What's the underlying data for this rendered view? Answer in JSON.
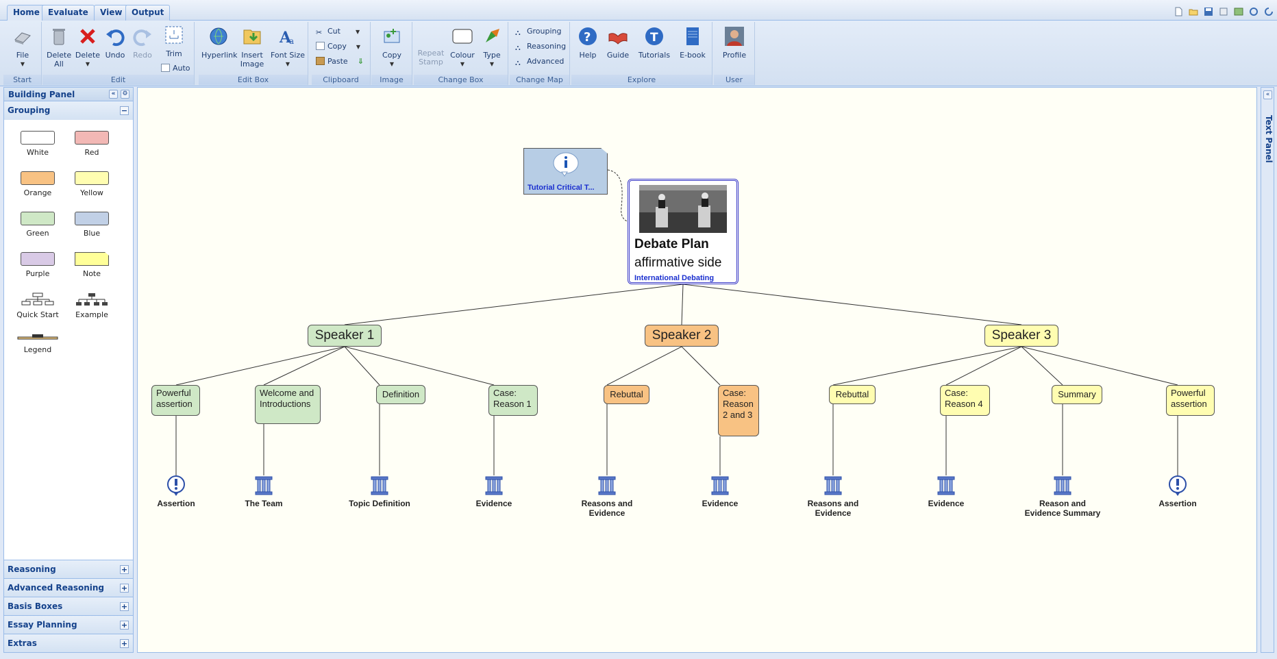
{
  "tabs": [
    "Home",
    "Evaluate",
    "View",
    "Output"
  ],
  "ribbon": {
    "start": {
      "label": "Start",
      "file": "File"
    },
    "edit": {
      "label": "Edit",
      "delete_all": "Delete All",
      "delete_all_l1": "Delete",
      "delete_all_l2": "All",
      "delete": "Delete",
      "undo": "Undo",
      "redo": "Redo",
      "trim": "Trim",
      "auto": "Auto"
    },
    "edit_box": {
      "label": "Edit Box",
      "hyperlink": "Hyperlink",
      "insert_image_l1": "Insert",
      "insert_image_l2": "Image",
      "font_size": "Font Size"
    },
    "clipboard": {
      "label": "Clipboard",
      "cut": "Cut",
      "copy": "Copy",
      "paste": "Paste"
    },
    "image": {
      "label": "Image",
      "copy": "Copy"
    },
    "change_box": {
      "label": "Change Box",
      "repeat_l1": "Repeat",
      "repeat_l2": "Stamp",
      "colour": "Colour",
      "type": "Type"
    },
    "change_map": {
      "label": "Change Map",
      "grouping": "Grouping",
      "reasoning": "Reasoning",
      "advanced": "Advanced"
    },
    "explore": {
      "label": "Explore",
      "help": "Help",
      "guide": "Guide",
      "tutorials": "Tutorials",
      "ebook": "E-book"
    },
    "user": {
      "label": "User",
      "profile": "Profile"
    }
  },
  "building_panel": {
    "title": "Building Panel",
    "grouping": "Grouping",
    "swatches": [
      {
        "label": "White",
        "color": "#ffffff"
      },
      {
        "label": "Red",
        "color": "#f2b8b5"
      },
      {
        "label": "Orange",
        "color": "#f8c283"
      },
      {
        "label": "Yellow",
        "color": "#fffdb1"
      },
      {
        "label": "Green",
        "color": "#cfe8c6"
      },
      {
        "label": "Blue",
        "color": "#c1d0e6"
      },
      {
        "label": "Purple",
        "color": "#d9cae6"
      },
      {
        "label": "Note",
        "color": "#ffff99"
      }
    ],
    "templates": [
      "Quick Start",
      "Example",
      "Legend"
    ],
    "sections": [
      "Reasoning",
      "Advanced Reasoning",
      "Basis Boxes",
      "Essay Planning",
      "Extras"
    ]
  },
  "text_panel": "Text Panel",
  "map": {
    "note": "Tutorial Critical T...",
    "root": {
      "title": "Debate Plan",
      "subtitle": "affirmative side",
      "link": "International Debating"
    },
    "speakers": [
      "Speaker 1",
      "Speaker 2",
      "Speaker 3"
    ],
    "boxes": [
      {
        "text": "Powerful assertion",
        "leaf": "Assertion"
      },
      {
        "text": "Welcome and Introductions",
        "leaf": "The Team"
      },
      {
        "text": "Definition",
        "leaf": "Topic Definition"
      },
      {
        "text": "Case: Reason 1",
        "leaf": "Evidence"
      },
      {
        "text": "Rebuttal",
        "leaf": "Reasons and Evidence"
      },
      {
        "text": "Case: Reason 2 and 3",
        "leaf": "Evidence"
      },
      {
        "text": "Rebuttal",
        "leaf": "Reasons and Evidence"
      },
      {
        "text": "Case: Reason 4",
        "leaf": "Evidence"
      },
      {
        "text": "Summary",
        "leaf": "Reason and Evidence Summary"
      },
      {
        "text": "Powerful assertion",
        "leaf": "Assertion"
      }
    ]
  },
  "colors": {
    "speaker1": "#cfe8c6",
    "speaker2": "#f8c283",
    "speaker3": "#fffdb1",
    "note": "#b7cde5",
    "accent": "#15428b"
  }
}
